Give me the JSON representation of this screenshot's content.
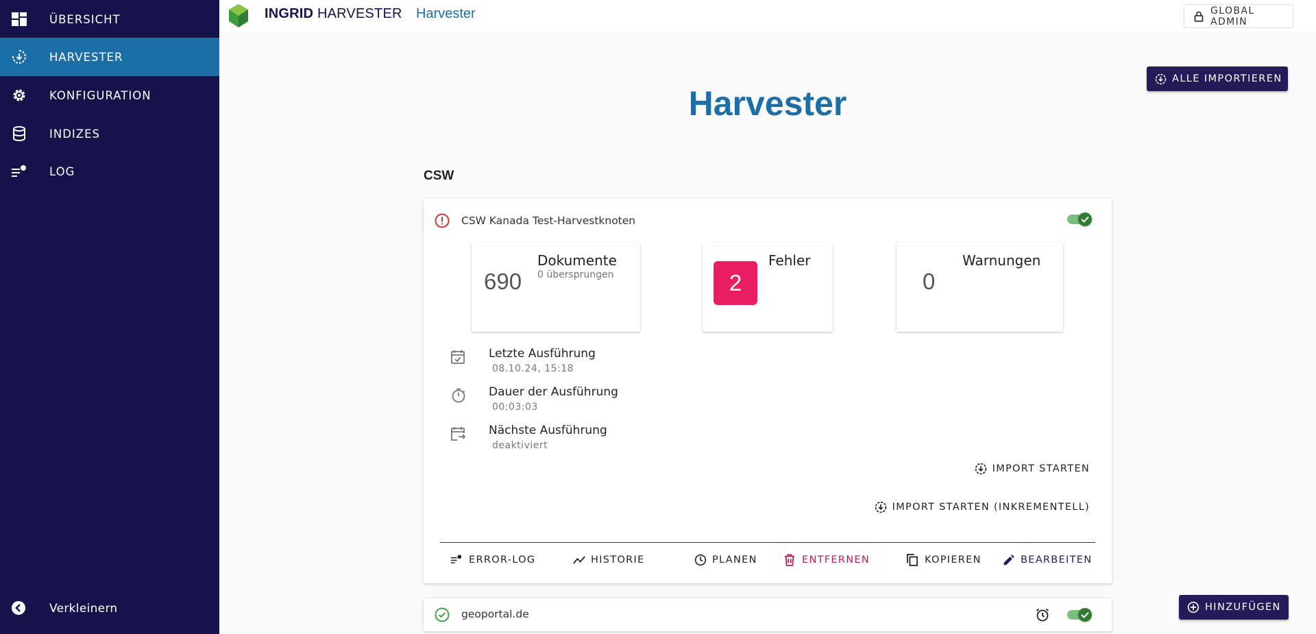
{
  "sidebar": {
    "items": [
      {
        "label": "ÜBERSICHT",
        "icon": "dashboard-icon"
      },
      {
        "label": "HARVESTER",
        "icon": "harvester-icon"
      },
      {
        "label": "KONFIGURATION",
        "icon": "gear-icon"
      },
      {
        "label": "INDIZES",
        "icon": "database-icon"
      },
      {
        "label": "LOG",
        "icon": "log-icon"
      }
    ],
    "collapse_label": "Verkleinern"
  },
  "header": {
    "brand_bold": "INGRID",
    "brand_rest": " HARVESTER",
    "breadcrumb": "Harvester",
    "admin_label": "GLOBAL ADMIN"
  },
  "main": {
    "import_all_label": "ALLE IMPORTIEREN",
    "title": "Harvester",
    "section": "CSW",
    "add_label": "HINZUFÜGEN"
  },
  "harvesters": [
    {
      "name": "CSW Kanada Test-Harvestknoten",
      "status": "error",
      "enabled": true,
      "documents": {
        "count": "690",
        "label": "Dokumente",
        "skipped": "0 übersprungen"
      },
      "errors": {
        "count": "2",
        "label": "Fehler"
      },
      "warnings": {
        "count": "0",
        "label": "Warnungen"
      },
      "last_run": {
        "label": "Letzte Ausführung",
        "value": "08.10.24, 15:18"
      },
      "duration": {
        "label": "Dauer der Ausführung",
        "value": "00:03:03"
      },
      "next_run": {
        "label": "Nächste Ausführung",
        "value": "deaktiviert"
      },
      "actions": {
        "import": "IMPORT STARTEN",
        "import_incremental": "IMPORT STARTEN (INKREMENTELL)",
        "error_log": "ERROR-LOG",
        "history": "HISTORIE",
        "schedule": "PLANEN",
        "remove": "ENTFERNEN",
        "copy": "KOPIEREN",
        "edit": "BEARBEITEN"
      }
    },
    {
      "name": "geoportal.de",
      "status": "ok",
      "enabled": true
    }
  ],
  "colors": {
    "sidebar_bg": "#16124a",
    "active": "#1b6ea6",
    "primary_button": "#241c58",
    "error_badge": "#e91e63",
    "toggle_on": "#2e7d32",
    "danger": "#c2185b"
  }
}
